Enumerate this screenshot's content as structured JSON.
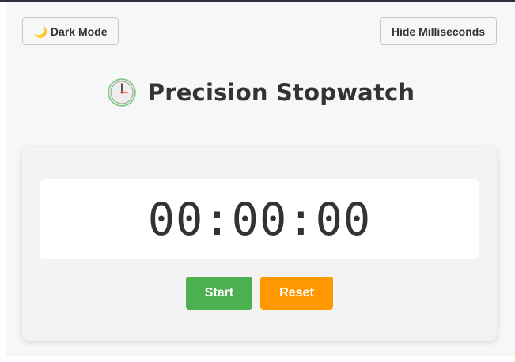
{
  "toolbar": {
    "dark_mode_label": "Dark Mode",
    "dark_mode_icon": "moon-icon",
    "hide_ms_label": "Hide Milliseconds"
  },
  "header": {
    "title": "Precision Stopwatch",
    "icon": "stopwatch-icon"
  },
  "stopwatch": {
    "time": "00:00:00",
    "start_label": "Start",
    "reset_label": "Reset",
    "start_color": "#4caf50",
    "reset_color": "#ff9800"
  }
}
